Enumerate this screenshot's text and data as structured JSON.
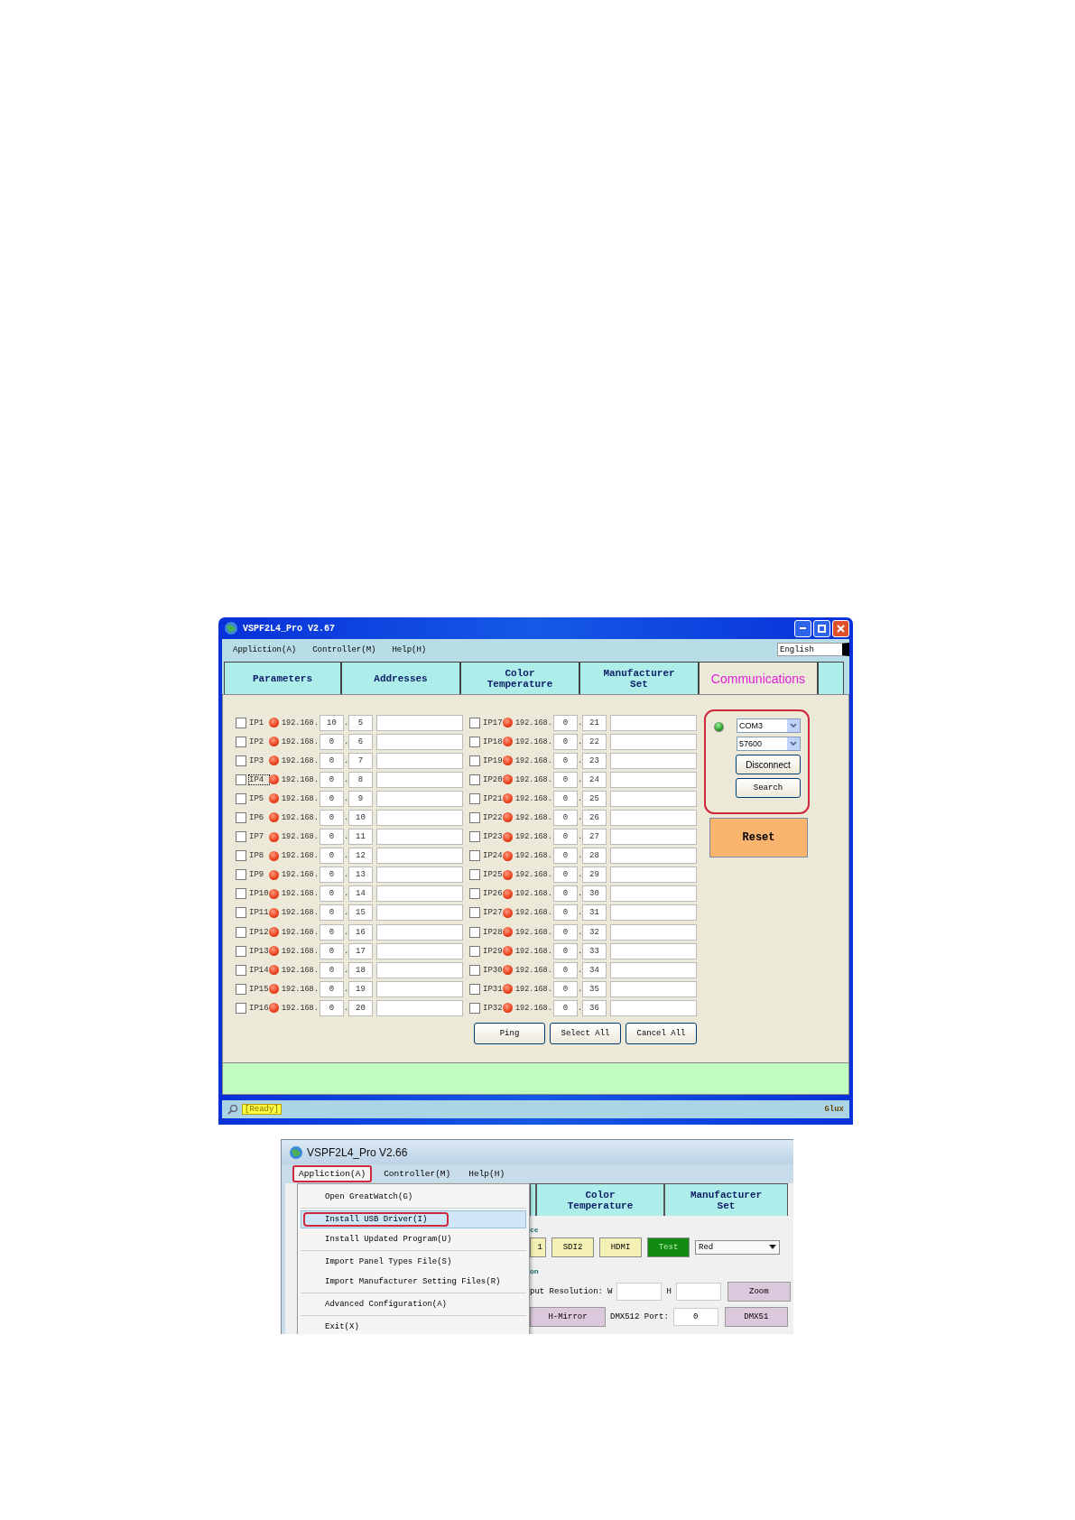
{
  "main_window": {
    "title": "VSPF2L4_Pro V2.67",
    "menu": [
      "Appliction(A)",
      "Controller(M)",
      "Help(H)"
    ],
    "language": "English",
    "tabs": [
      {
        "label": "Parameters",
        "selected": false
      },
      {
        "label": "Addresses",
        "selected": false
      },
      {
        "label": "Color Temperature",
        "selected": false
      },
      {
        "label": "Manufacturer Set",
        "selected": false
      },
      {
        "label": "Communications",
        "selected": true
      }
    ],
    "ip_columns": [
      [
        {
          "label": "IP1",
          "checked": false,
          "focused": false,
          "prefix": "192.168.",
          "octet_3": "10",
          "dot": ".",
          "octet_4": "5"
        },
        {
          "label": "IP2",
          "checked": false,
          "focused": false,
          "prefix": "192.168.",
          "octet_3": "0",
          "dot": ".",
          "octet_4": "6"
        },
        {
          "label": "IP3",
          "checked": false,
          "focused": false,
          "prefix": "192.168.",
          "octet_3": "0",
          "dot": ".",
          "octet_4": "7"
        },
        {
          "label": "IP4",
          "checked": false,
          "focused": true,
          "prefix": "192.168.",
          "octet_3": "0",
          "dot": ".",
          "octet_4": "8"
        },
        {
          "label": "IP5",
          "checked": false,
          "focused": false,
          "prefix": "192.168.",
          "octet_3": "0",
          "dot": ".",
          "octet_4": "9"
        },
        {
          "label": "IP6",
          "checked": false,
          "focused": false,
          "prefix": "192.168.",
          "octet_3": "0",
          "dot": ".",
          "octet_4": "10"
        },
        {
          "label": "IP7",
          "checked": false,
          "focused": false,
          "prefix": "192.168.",
          "octet_3": "0",
          "dot": ".",
          "octet_4": "11"
        },
        {
          "label": "IP8",
          "checked": false,
          "focused": false,
          "prefix": "192.168.",
          "octet_3": "0",
          "dot": ".",
          "octet_4": "12"
        },
        {
          "label": "IP9",
          "checked": false,
          "focused": false,
          "prefix": "192.168.",
          "octet_3": "0",
          "dot": ".",
          "octet_4": "13"
        },
        {
          "label": "IP10",
          "checked": false,
          "focused": false,
          "prefix": "192.168.",
          "octet_3": "0",
          "dot": ".",
          "octet_4": "14"
        },
        {
          "label": "IP11",
          "checked": false,
          "focused": false,
          "prefix": "192.168.",
          "octet_3": "0",
          "dot": ".",
          "octet_4": "15"
        },
        {
          "label": "IP12",
          "checked": false,
          "focused": false,
          "prefix": "192.168.",
          "octet_3": "0",
          "dot": ".",
          "octet_4": "16"
        },
        {
          "label": "IP13",
          "checked": false,
          "focused": false,
          "prefix": "192.168.",
          "octet_3": "0",
          "dot": ".",
          "octet_4": "17"
        },
        {
          "label": "IP14",
          "checked": false,
          "focused": false,
          "prefix": "192.168.",
          "octet_3": "0",
          "dot": ".",
          "octet_4": "18"
        },
        {
          "label": "IP15",
          "checked": false,
          "focused": false,
          "prefix": "192.168.",
          "octet_3": "0",
          "dot": ".",
          "octet_4": "19"
        },
        {
          "label": "IP16",
          "checked": false,
          "focused": false,
          "prefix": "192.168.",
          "octet_3": "0",
          "dot": ".",
          "octet_4": "20"
        }
      ],
      [
        {
          "label": "IP17",
          "checked": false,
          "focused": false,
          "prefix": "192.168.",
          "octet_3": "0",
          "dot": ".",
          "octet_4": "21"
        },
        {
          "label": "IP18",
          "checked": false,
          "focused": false,
          "prefix": "192.168.",
          "octet_3": "0",
          "dot": ".",
          "octet_4": "22"
        },
        {
          "label": "IP19",
          "checked": false,
          "focused": false,
          "prefix": "192.168.",
          "octet_3": "0",
          "dot": ".",
          "octet_4": "23"
        },
        {
          "label": "IP20",
          "checked": false,
          "focused": false,
          "prefix": "192.168.",
          "octet_3": "0",
          "dot": ".",
          "octet_4": "24"
        },
        {
          "label": "IP21",
          "checked": false,
          "focused": false,
          "prefix": "192.168.",
          "octet_3": "0",
          "dot": ".",
          "octet_4": "25"
        },
        {
          "label": "IP22",
          "checked": false,
          "focused": false,
          "prefix": "192.168.",
          "octet_3": "0",
          "dot": ".",
          "octet_4": "26"
        },
        {
          "label": "IP23",
          "checked": false,
          "focused": false,
          "prefix": "192.168.",
          "octet_3": "0",
          "dot": ".",
          "octet_4": "27"
        },
        {
          "label": "IP24",
          "checked": false,
          "focused": false,
          "prefix": "192.168.",
          "octet_3": "0",
          "dot": ".",
          "octet_4": "28"
        },
        {
          "label": "IP25",
          "checked": false,
          "focused": false,
          "prefix": "192.168.",
          "octet_3": "0",
          "dot": ".",
          "octet_4": "29"
        },
        {
          "label": "IP26",
          "checked": false,
          "focused": false,
          "prefix": "192.168.",
          "octet_3": "0",
          "dot": ".",
          "octet_4": "30"
        },
        {
          "label": "IP27",
          "checked": false,
          "focused": false,
          "prefix": "192.168.",
          "octet_3": "0",
          "dot": ".",
          "octet_4": "31"
        },
        {
          "label": "IP28",
          "checked": false,
          "focused": false,
          "prefix": "192.168.",
          "octet_3": "0",
          "dot": ".",
          "octet_4": "32"
        },
        {
          "label": "IP29",
          "checked": false,
          "focused": false,
          "prefix": "192.168.",
          "octet_3": "0",
          "dot": ".",
          "octet_4": "33"
        },
        {
          "label": "IP30",
          "checked": false,
          "focused": false,
          "prefix": "192.168.",
          "octet_3": "0",
          "dot": ".",
          "octet_4": "34"
        },
        {
          "label": "IP31",
          "checked": false,
          "focused": false,
          "prefix": "192.168.",
          "octet_3": "0",
          "dot": ".",
          "octet_4": "35"
        },
        {
          "label": "IP32",
          "checked": false,
          "focused": false,
          "prefix": "192.168.",
          "octet_3": "0",
          "dot": ".",
          "octet_4": "36"
        }
      ]
    ],
    "actions": [
      "Ping",
      "Select All",
      "Cancel All"
    ],
    "connection": {
      "connected": true,
      "annotated": true,
      "port": "COM3",
      "baud": "57600",
      "buttons": [
        "Disconnect",
        "Search"
      ]
    },
    "reset": "Reset",
    "status": {
      "state": "[Ready]",
      "right": "Glux"
    }
  },
  "second_window": {
    "title": "VSPF2L4_Pro V2.66",
    "menu": [
      {
        "label": "Appliction(A)",
        "open": true,
        "annotated": true
      },
      {
        "label": "Controller(M)",
        "open": false,
        "annotated": false
      },
      {
        "label": "Help(H)",
        "open": false,
        "annotated": false
      }
    ],
    "dropdown": [
      [
        {
          "label": "Open GreatWatch(G)",
          "selected": false,
          "annotated": false
        }
      ],
      [
        {
          "label": "Install USB Driver(I)",
          "selected": true,
          "annotated": true
        },
        {
          "label": "Install Updated Program(U)",
          "selected": false,
          "annotated": false
        }
      ],
      [
        {
          "label": "Import Panel Types File(S)",
          "selected": false,
          "annotated": false
        },
        {
          "label": "Import Manufacturer Setting Files(R)",
          "selected": false,
          "annotated": false
        }
      ],
      [
        {
          "label": "Advanced Configuration(A)",
          "selected": false,
          "annotated": false
        }
      ],
      [
        {
          "label": "Exit(X)",
          "selected": false,
          "annotated": false
        }
      ]
    ],
    "tabs": [
      "Color Temperature",
      "Manufacturer Set"
    ],
    "source_group": "ce",
    "source_buttons": [
      {
        "label": "1",
        "active": false
      },
      {
        "label": "SDI2",
        "active": false
      },
      {
        "label": "HDMI",
        "active": false
      },
      {
        "label": "Test",
        "active": true
      }
    ],
    "color_select": "Red",
    "output_group": "on",
    "resolution_label": "put Resolution:",
    "w_label": "W",
    "h_label": "H",
    "zoom_button": "Zoom",
    "mirror_button": "H-Mirror",
    "dmx_label": "DMX512 Port:",
    "dmx_port": "0",
    "dmx_button": "DMX51"
  }
}
